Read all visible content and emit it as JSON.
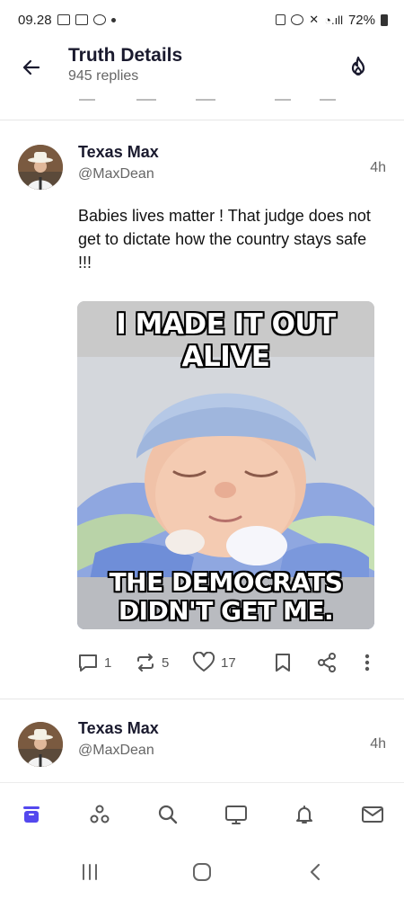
{
  "status_bar": {
    "time": "09.28",
    "battery": "72%"
  },
  "header": {
    "title": "Truth Details",
    "subtitle": "945 replies",
    "back_icon": "arrow-left-icon",
    "right_icon": "flame-icon"
  },
  "posts": [
    {
      "author": "Texas Max",
      "handle": "@MaxDean",
      "time": "4h",
      "text": "Babies lives matter ! That judge does not get to dictate how the country stays safe !!!",
      "meme": {
        "top_caption": "I MADE IT OUT ALIVE",
        "bottom_caption_line1": "THE DEMOCRATS",
        "bottom_caption_line2": "DIDN'T GET ME."
      },
      "actions": {
        "replies": "1",
        "retruths": "5",
        "likes": "17"
      }
    },
    {
      "author": "Texas Max",
      "handle": "@MaxDean",
      "time": "4h"
    }
  ],
  "bottom_nav": [
    "home-icon",
    "groups-icon",
    "search-icon",
    "tv-icon",
    "bell-icon",
    "mail-icon"
  ],
  "colors": {
    "accent": "#5448ee",
    "text": "#111111",
    "muted": "#666666",
    "icon": "#555555"
  }
}
